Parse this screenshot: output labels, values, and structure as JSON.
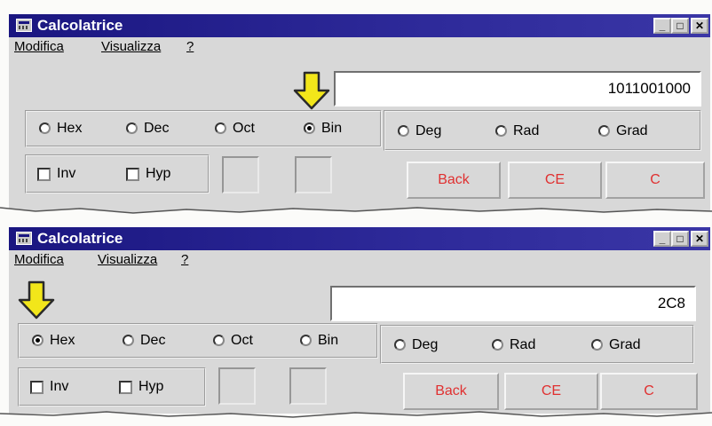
{
  "colors": {
    "titlebar": "#1a1680",
    "button_text": "#e03030",
    "arrow": "#f2e61a"
  },
  "windows": [
    {
      "title": "Calcolatrice",
      "menus": [
        "Modifica",
        "Visualizza",
        "?"
      ],
      "display": "1011001000",
      "number_base": [
        {
          "label": "Hex",
          "selected": false
        },
        {
          "label": "Dec",
          "selected": false
        },
        {
          "label": "Oct",
          "selected": false
        },
        {
          "label": "Bin",
          "selected": true
        }
      ],
      "angle_unit": [
        {
          "label": "Deg",
          "selected": false
        },
        {
          "label": "Rad",
          "selected": false
        },
        {
          "label": "Grad",
          "selected": false
        }
      ],
      "checks": [
        "Inv",
        "Hyp"
      ],
      "buttons": [
        "Back",
        "CE",
        "C"
      ],
      "arrow_icon": "arrow-down-icon"
    },
    {
      "title": "Calcolatrice",
      "menus": [
        "Modifica",
        "Visualizza",
        "?"
      ],
      "display": "2C8",
      "number_base": [
        {
          "label": "Hex",
          "selected": true
        },
        {
          "label": "Dec",
          "selected": false
        },
        {
          "label": "Oct",
          "selected": false
        },
        {
          "label": "Bin",
          "selected": false
        }
      ],
      "angle_unit": [
        {
          "label": "Deg",
          "selected": false
        },
        {
          "label": "Rad",
          "selected": false
        },
        {
          "label": "Grad",
          "selected": false
        }
      ],
      "checks": [
        "Inv",
        "Hyp"
      ],
      "buttons": [
        "Back",
        "CE",
        "C"
      ],
      "arrow_icon": "arrow-down-icon"
    }
  ]
}
